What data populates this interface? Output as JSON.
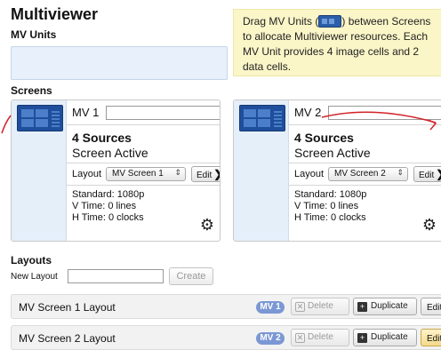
{
  "app": {
    "title": "Multiviewer"
  },
  "mv_units": {
    "label": "MV Units"
  },
  "info": {
    "part1": "Drag MV Units (",
    "part2": ") between Screens to allocate Multiviewer resources. Each MV Unit provides 4 image cells and 2 data cells.",
    "unit_icon": "mv-unit-icon"
  },
  "screens": {
    "label": "Screens",
    "items": [
      {
        "name_label": "MV 1",
        "name_value": "",
        "sources": "4 Sources",
        "status": "Screen Active",
        "layout_label": "Layout",
        "layout_value": "MV Screen 1",
        "edit_label": "Edit",
        "standard": "Standard: 1080p",
        "vtime": "V Time: 0 lines",
        "htime": "H Time: 0 clocks",
        "settings_icon": "gear-icon"
      },
      {
        "name_label": "MV 2",
        "name_value": "",
        "sources": "4 Sources",
        "status": "Screen Active",
        "layout_label": "Layout",
        "layout_value": "MV Screen 2",
        "edit_label": "Edit",
        "standard": "Standard: 1080p",
        "vtime": "V Time: 0 lines",
        "htime": "H Time: 0 clocks",
        "settings_icon": "gear-icon"
      }
    ]
  },
  "layouts": {
    "label": "Layouts",
    "new_layout_label": "New Layout",
    "new_layout_value": "",
    "create_label": "Create",
    "items": [
      {
        "name": "MV Screen 1 Layout",
        "badge": "MV 1",
        "delete_label": "Delete",
        "duplicate_label": "Duplicate",
        "edit_label": "Edit"
      },
      {
        "name": "MV Screen 2 Layout",
        "badge": "MV 2",
        "delete_label": "Delete",
        "duplicate_label": "Duplicate",
        "edit_label": "Edit"
      }
    ]
  },
  "colors": {
    "accent": "#2b5ea8",
    "badge": "#7b98d4",
    "info_bg": "#fbf6c8",
    "drop_zone": "#e8f1fb",
    "drag_line": "#d2232a"
  }
}
